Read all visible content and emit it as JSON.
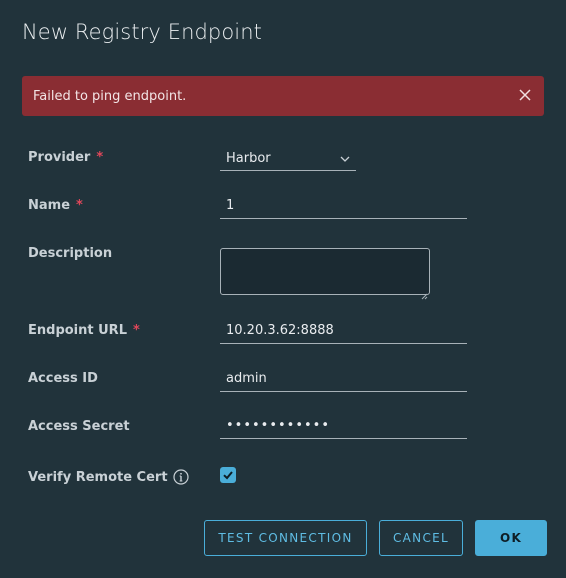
{
  "dialog": {
    "title": "New Registry Endpoint"
  },
  "alert": {
    "message": "Failed to ping endpoint.",
    "close_icon": "close-icon",
    "color": "#8a2d33"
  },
  "form": {
    "provider": {
      "label": "Provider",
      "required_mark": "*",
      "value": "Harbor"
    },
    "name": {
      "label": "Name",
      "required_mark": "*",
      "value": "1"
    },
    "description": {
      "label": "Description",
      "value": ""
    },
    "endpoint_url": {
      "label": "Endpoint URL",
      "required_mark": "*",
      "value": "10.20.3.62:8888"
    },
    "access_id": {
      "label": "Access ID",
      "value": "admin"
    },
    "access_secret": {
      "label": "Access Secret",
      "value": "••••••••••••"
    },
    "verify_remote_cert": {
      "label": "Verify Remote Cert",
      "checked": true,
      "info_icon": "info-icon"
    }
  },
  "buttons": {
    "test_connection": "TEST CONNECTION",
    "cancel": "CANCEL",
    "ok": "OK"
  },
  "colors": {
    "background": "#21333b",
    "accent": "#4aaed9",
    "required": "#e1475a"
  }
}
